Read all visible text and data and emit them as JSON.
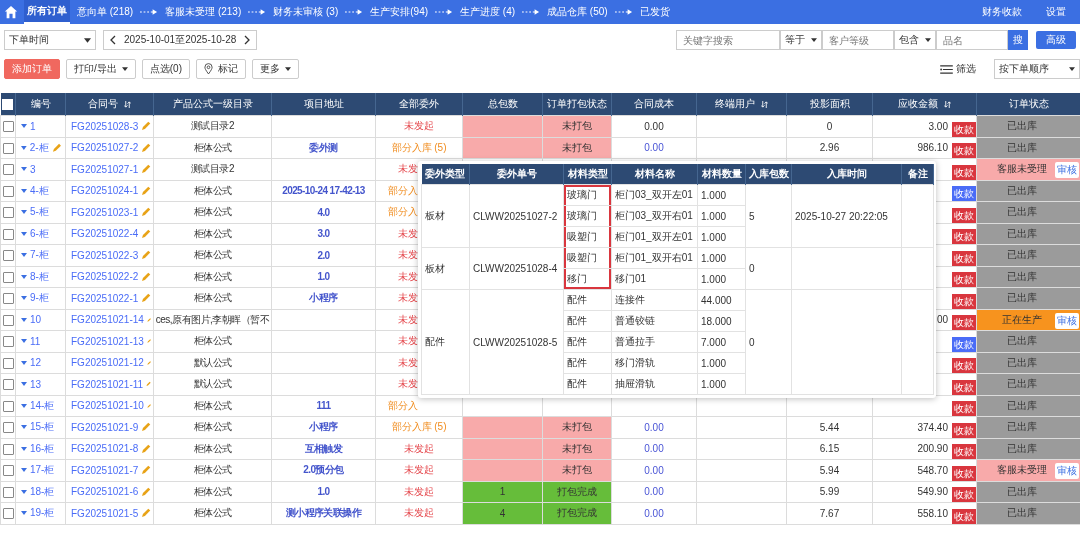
{
  "nav": {
    "tabs": [
      {
        "label": "所有订单",
        "selected": true,
        "arrow_before": false
      },
      {
        "label": "意向单 (218)",
        "selected": false,
        "arrow_before": false
      },
      {
        "label": "客服未受理 (213)",
        "selected": false,
        "arrow_before": true
      },
      {
        "label": "财务未审核 (3)",
        "selected": false,
        "arrow_before": true
      },
      {
        "label": "生产安排(94)",
        "selected": false,
        "arrow_before": true
      },
      {
        "label": "生产进度 (4)",
        "selected": false,
        "arrow_before": true
      },
      {
        "label": "成品仓库 (50)",
        "selected": false,
        "arrow_before": true
      },
      {
        "label": "已发货",
        "selected": false,
        "arrow_before": true
      }
    ],
    "right": [
      "财务收款",
      "设置"
    ]
  },
  "toolbar": {
    "time_field": "下单时间",
    "date_range": "2025-10-01至2025-10-28",
    "keyword_placeholder": "关键字搜索",
    "operator_1": "等于",
    "level_placeholder": "客户等级",
    "operator_2": "包含",
    "name_placeholder": "品名",
    "search": "搜",
    "advanced": "高级"
  },
  "actions": [
    {
      "label": "添加订单",
      "kind": "primary"
    },
    {
      "label": "打印/导出",
      "kind": "dropdown"
    },
    {
      "label": "点选(0)",
      "kind": "plain"
    },
    {
      "label": "标记",
      "kind": "pin"
    },
    {
      "label": "更多",
      "kind": "dropdown"
    }
  ],
  "filter": "筛选",
  "sort_order": "按下单顺序",
  "table": {
    "select_all": {
      "checked": false
    },
    "columns": [
      {
        "label": "编号",
        "sortable": false
      },
      {
        "label": "合同号",
        "sortable": true
      },
      {
        "label": "产品公式一级目录",
        "sortable": false
      },
      {
        "label": "项目地址",
        "sortable": false
      },
      {
        "label": "全部委外",
        "sortable": false
      },
      {
        "label": "总包数",
        "sortable": false
      },
      {
        "label": "订单打包状态",
        "sortable": false
      },
      {
        "label": "合同成本",
        "sortable": false
      },
      {
        "label": "终端用户",
        "sortable": true
      },
      {
        "label": "投影面积",
        "sortable": false
      },
      {
        "label": "应收金额",
        "sortable": true
      },
      {
        "label": "订单状态",
        "sortable": false
      }
    ],
    "rows": [
      {
        "checked": false,
        "number": "1",
        "number_edit": false,
        "contract": "FG20251028-3",
        "formula": "测试目录2",
        "outsource": {
          "text": "未发起",
          "partial": false
        },
        "packing": {
          "text": "未打包",
          "packed": false
        },
        "cost": {
          "text": "0.00",
          "link": false
        },
        "area": "0",
        "amount": "3.00",
        "payment": {
          "label": "收款",
          "color": "#d9363e"
        },
        "status": {
          "label": "已出库",
          "kind": "shipped"
        }
      },
      {
        "checked": false,
        "number": "2-柜",
        "number_edit": true,
        "contract": "FG20251027-2",
        "formula": "柜体公式",
        "address": "委外测",
        "outsource": {
          "text": "部分入库 (5)",
          "partial": true
        },
        "packing": {
          "text": "未打包",
          "packed": false
        },
        "cost": {
          "text": "0.00",
          "link": true
        },
        "area": "2.96",
        "amount": "986.10",
        "payment": {
          "label": "收款",
          "color": "#d9363e"
        },
        "status": {
          "label": "已出库",
          "kind": "shipped"
        }
      },
      {
        "checked": false,
        "number": "3",
        "number_edit": false,
        "contract": "FG20251027-1",
        "formula": "测试目录2",
        "outsource": {
          "text": "未发",
          "partial": false
        },
        "payment": {
          "label": "收款",
          "color": "#d9363e"
        },
        "status": {
          "label": "客服未受理",
          "kind": "unaccepted",
          "review": "审核"
        }
      },
      {
        "checked": false,
        "number": "4-柜",
        "number_edit": false,
        "contract": "FG20251024-1",
        "formula": "柜体公式",
        "address": "2025-10-24 17-42-13",
        "outsource": {
          "text": "部分入",
          "partial": true
        },
        "payment": {
          "label": "收款",
          "color": "#4a6cf7"
        },
        "status": {
          "label": "已出库",
          "kind": "shipped"
        }
      },
      {
        "checked": false,
        "number": "5-柜",
        "number_edit": false,
        "contract": "FG20251023-1",
        "formula": "柜体公式",
        "address": "4.0",
        "outsource": {
          "text": "部分入",
          "partial": true
        },
        "payment": {
          "label": "收款",
          "color": "#d9363e"
        },
        "status": {
          "label": "已出库",
          "kind": "shipped"
        }
      },
      {
        "checked": false,
        "number": "6-柜",
        "number_edit": false,
        "contract": "FG20251022-4",
        "formula": "柜体公式",
        "address": "3.0",
        "outsource": {
          "text": "未发",
          "partial": false
        },
        "payment": {
          "label": "收款",
          "color": "#d9363e"
        },
        "status": {
          "label": "已出库",
          "kind": "shipped"
        }
      },
      {
        "checked": false,
        "number": "7-柜",
        "number_edit": false,
        "contract": "FG20251022-3",
        "formula": "柜体公式",
        "address": "2.0",
        "outsource": {
          "text": "未发",
          "partial": false
        },
        "payment": {
          "label": "收款",
          "color": "#d9363e"
        },
        "status": {
          "label": "已出库",
          "kind": "shipped"
        }
      },
      {
        "checked": false,
        "number": "8-柜",
        "number_edit": false,
        "contract": "FG20251022-2",
        "formula": "柜体公式",
        "address": "1.0",
        "outsource": {
          "text": "未发",
          "partial": false
        },
        "payment": {
          "label": "收款",
          "color": "#d9363e"
        },
        "status": {
          "label": "已出库",
          "kind": "shipped"
        }
      },
      {
        "checked": false,
        "number": "9-柜",
        "number_edit": false,
        "contract": "FG20251022-1",
        "formula": "柜体公式",
        "address": "小程序",
        "outsource": {
          "text": "未发",
          "partial": false
        },
        "payment": {
          "label": "收款",
          "color": "#d9363e"
        },
        "status": {
          "label": "已出库",
          "kind": "shipped"
        }
      },
      {
        "checked": false,
        "number": "10",
        "number_edit": false,
        "contract": "FG20251021-14",
        "formula": "ces,原有图片,李朝晖（暂不",
        "outsource": {
          "text": "未发",
          "partial": false
        },
        "amount": "00",
        "payment": {
          "label": "收款",
          "color": "#d9363e"
        },
        "status": {
          "label": "正在生产",
          "kind": "producing",
          "review": "审核"
        }
      },
      {
        "checked": false,
        "number": "11",
        "number_edit": false,
        "contract": "FG20251021-13",
        "formula": "柜体公式",
        "outsource": {
          "text": "未发",
          "partial": false
        },
        "payment": {
          "label": "收款",
          "color": "#4a6cf7"
        },
        "status": {
          "label": "已出库",
          "kind": "shipped"
        }
      },
      {
        "checked": false,
        "number": "12",
        "number_edit": false,
        "contract": "FG20251021-12",
        "formula": "默认公式",
        "outsource": {
          "text": "未发",
          "partial": false
        },
        "payment": {
          "label": "收款",
          "color": "#d9363e"
        },
        "status": {
          "label": "已出库",
          "kind": "shipped"
        }
      },
      {
        "checked": false,
        "number": "13",
        "number_edit": false,
        "contract": "FG20251021-11",
        "formula": "默认公式",
        "outsource": {
          "text": "未发",
          "partial": false
        },
        "payment": {
          "label": "收款",
          "color": "#d9363e"
        },
        "status": {
          "label": "已出库",
          "kind": "shipped"
        }
      },
      {
        "checked": false,
        "number": "14-柜",
        "number_edit": false,
        "contract": "FG20251021-10",
        "formula": "柜体公式",
        "address": "111",
        "outsource": {
          "text": "部分入",
          "partial": true
        },
        "payment": {
          "label": "收款",
          "color": "#d9363e"
        },
        "status": {
          "label": "已出库",
          "kind": "shipped"
        }
      },
      {
        "checked": false,
        "number": "15-柜",
        "number_edit": false,
        "contract": "FG20251021-9",
        "formula": "柜体公式",
        "address": "小程序",
        "outsource": {
          "text": "部分入库 (5)",
          "partial": true
        },
        "packing": {
          "text": "未打包",
          "packed": false
        },
        "cost": {
          "text": "0.00",
          "link": true
        },
        "area": "5.44",
        "amount": "374.40",
        "payment": {
          "label": "收款",
          "color": "#d9363e"
        },
        "status": {
          "label": "已出库",
          "kind": "shipped"
        }
      },
      {
        "checked": false,
        "number": "16-柜",
        "number_edit": false,
        "contract": "FG20251021-8",
        "formula": "柜体公式",
        "address": "互相触发",
        "outsource": {
          "text": "未发起",
          "partial": false
        },
        "packing": {
          "text": "未打包",
          "packed": false
        },
        "cost": {
          "text": "0.00",
          "link": true
        },
        "area": "6.15",
        "amount": "200.90",
        "payment": {
          "label": "收款",
          "color": "#d9363e"
        },
        "status": {
          "label": "已出库",
          "kind": "shipped"
        }
      },
      {
        "checked": false,
        "number": "17-柜",
        "number_edit": false,
        "contract": "FG20251021-7",
        "formula": "柜体公式",
        "address": "2.0预分包",
        "outsource": {
          "text": "未发起",
          "partial": false
        },
        "packing": {
          "text": "未打包",
          "packed": false
        },
        "cost": {
          "text": "0.00",
          "link": true
        },
        "area": "5.94",
        "amount": "548.70",
        "payment": {
          "label": "收款",
          "color": "#d9363e"
        },
        "status": {
          "label": "客服未受理",
          "kind": "unaccepted",
          "review": "审核"
        }
      },
      {
        "checked": false,
        "number": "18-柜",
        "number_edit": false,
        "contract": "FG20251021-6",
        "formula": "柜体公式",
        "address": "1.0",
        "outsource": {
          "text": "未发起",
          "partial": false
        },
        "packages": "1",
        "packing": {
          "text": "打包完成",
          "packed": true
        },
        "cost": {
          "text": "0.00",
          "link": true
        },
        "area": "5.99",
        "amount": "549.90",
        "payment": {
          "label": "收款",
          "color": "#d9363e"
        },
        "status": {
          "label": "已出库",
          "kind": "shipped"
        }
      },
      {
        "checked": false,
        "number": "19-柜",
        "number_edit": false,
        "contract": "FG20251021-5",
        "formula": "柜体公式",
        "address": "测小程序关联操作",
        "outsource": {
          "text": "未发起",
          "partial": false
        },
        "packages": "4",
        "packing": {
          "text": "打包完成",
          "packed": true
        },
        "cost": {
          "text": "0.00",
          "link": true
        },
        "area": "7.67",
        "amount": "558.10",
        "payment": {
          "label": "收款",
          "color": "#d9363e"
        },
        "status": {
          "label": "已出库",
          "kind": "shipped"
        }
      }
    ]
  },
  "outsource_popup": {
    "columns": [
      "委外类型",
      "委外单号",
      "材料类型",
      "材料名称",
      "材料数量",
      "入库包数",
      "入库时间",
      "备注"
    ],
    "groups": [
      {
        "type": "板材",
        "order_no": "CLWW20251027-2",
        "packages": "5",
        "time": "2025-10-27 20:22:05",
        "items": [
          {
            "material_type": "玻璃门",
            "name": "柜门03_双开左01",
            "quantity": "1.000",
            "highlighted": true
          },
          {
            "material_type": "玻璃门",
            "name": "柜门03_双开右01",
            "quantity": "1.000",
            "highlighted": true
          },
          {
            "material_type": "吸塑门",
            "name": "柜门01_双开左01",
            "quantity": "1.000",
            "highlighted": true
          }
        ]
      },
      {
        "type": "板材",
        "order_no": "CLWW20251028-4",
        "packages": "0",
        "items": [
          {
            "material_type": "吸塑门",
            "name": "柜门01_双开右01",
            "quantity": "1.000",
            "highlighted": true
          },
          {
            "material_type": "移门",
            "name": "移门01",
            "quantity": "1.000",
            "highlighted": true
          }
        ]
      },
      {
        "type": "配件",
        "order_no": "CLWW20251028-5",
        "packages": "0",
        "items": [
          {
            "material_type": "配件",
            "name": "连接件",
            "quantity": "44.000",
            "highlighted": false
          },
          {
            "material_type": "配件",
            "name": "普通铰链",
            "quantity": "18.000",
            "highlighted": false
          },
          {
            "material_type": "配件",
            "name": "普通拉手",
            "quantity": "7.000",
            "highlighted": false
          },
          {
            "material_type": "配件",
            "name": "移门滑轨",
            "quantity": "1.000",
            "highlighted": false
          },
          {
            "material_type": "配件",
            "name": "抽屉滑轨",
            "quantity": "1.000",
            "highlighted": false
          }
        ]
      }
    ]
  }
}
